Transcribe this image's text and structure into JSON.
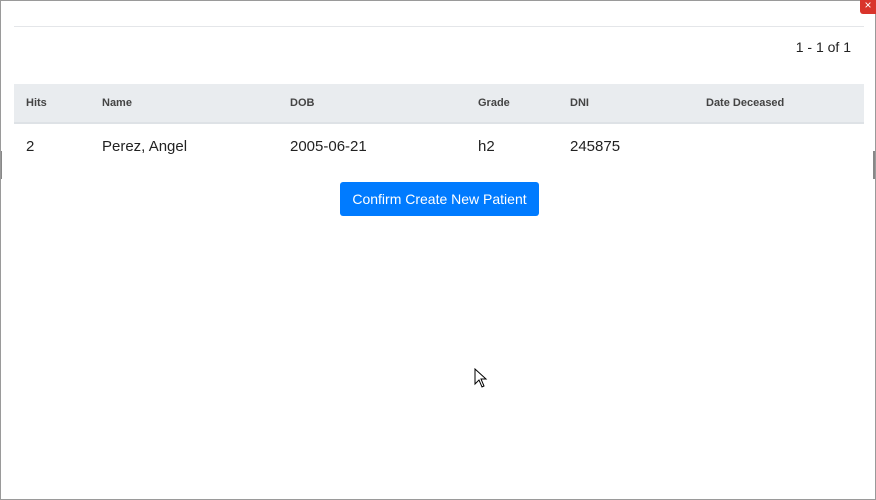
{
  "pagination": {
    "text": "1 - 1 of 1"
  },
  "table": {
    "columns": [
      "Hits",
      "Name",
      "DOB",
      "Grade",
      "DNI",
      "Date Deceased"
    ],
    "rows": [
      {
        "hits": "2",
        "name": "Perez, Angel",
        "dob": "2005-06-21",
        "grade": "h2",
        "dni": "245875",
        "date_deceased": ""
      }
    ]
  },
  "actions": {
    "confirm_label": "Confirm Create New Patient"
  },
  "colors": {
    "primary": "#007bff",
    "header_bg": "#e9ecef",
    "close": "#d9342b"
  },
  "icons": {
    "close": "close-icon",
    "cursor": "mouse-pointer-icon"
  }
}
